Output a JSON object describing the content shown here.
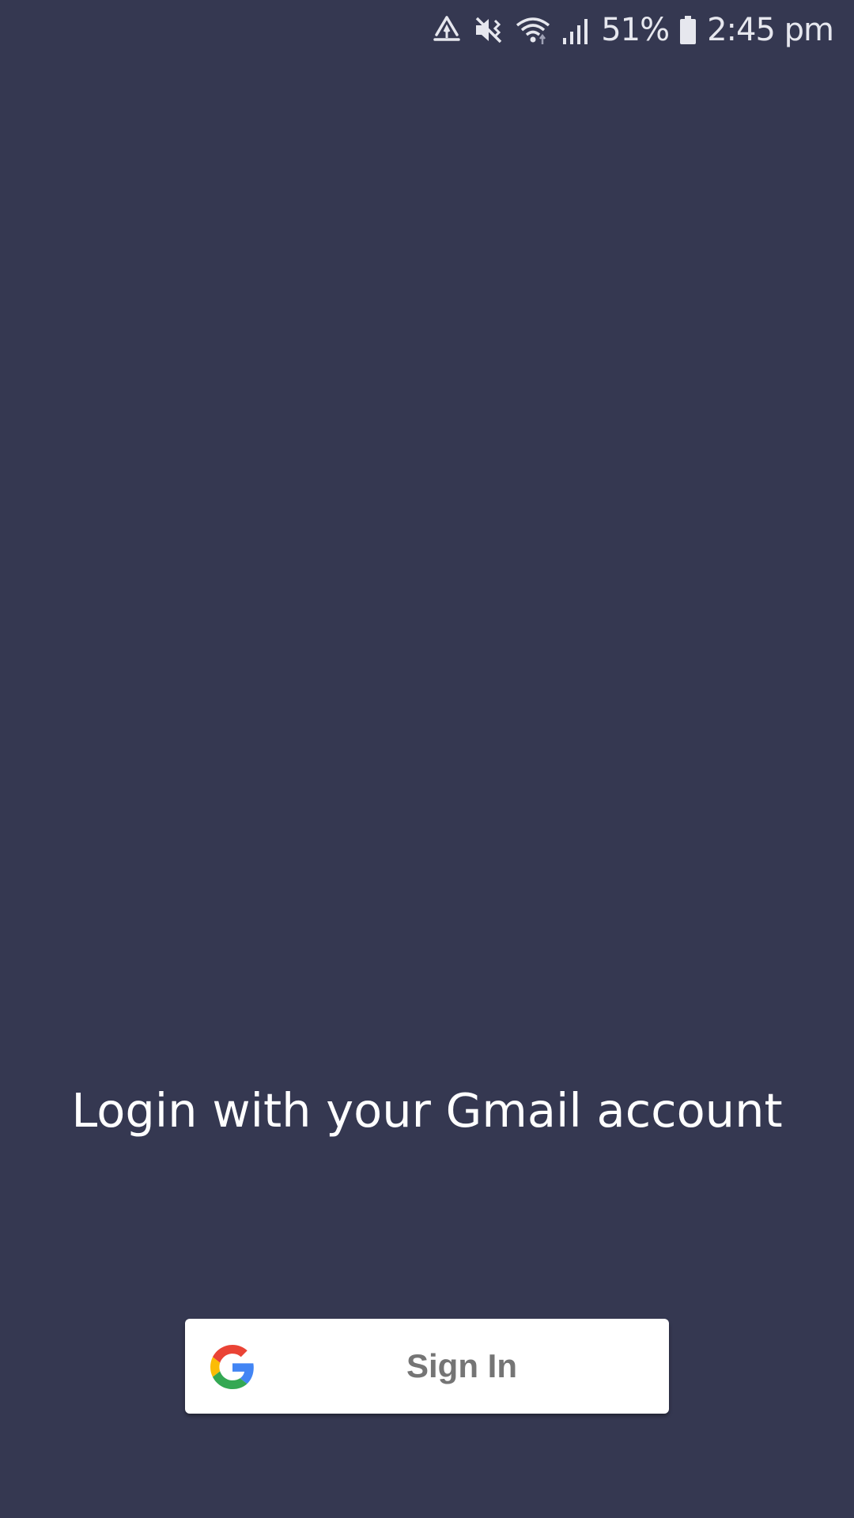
{
  "status_bar": {
    "battery_percent": "51%",
    "time": "2:45 pm",
    "icons": [
      "recycle-icon",
      "vibrate-mute-icon",
      "wifi-icon",
      "signal-icon",
      "battery-icon"
    ]
  },
  "login": {
    "prompt": "Login with your Gmail account",
    "sign_in_label": "Sign In"
  },
  "colors": {
    "background": "#353851",
    "button_bg": "#ffffff",
    "button_text": "#757575"
  }
}
